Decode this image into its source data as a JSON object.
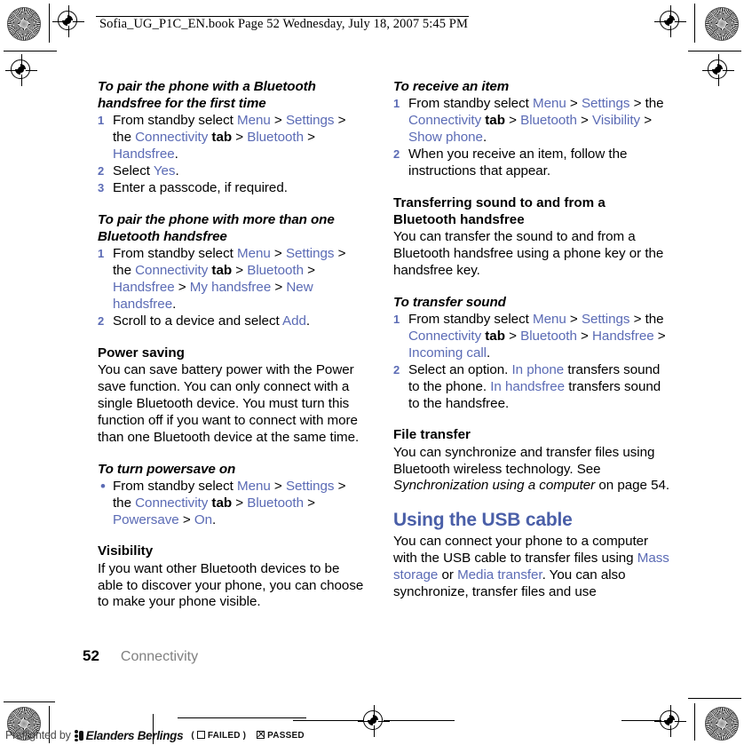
{
  "document": {
    "header_text": "Sofia_UG_P1C_EN.book  Page 52  Wednesday, July 18, 2007  5:45 PM",
    "folio_page": "52",
    "folio_chapter": "Connectivity",
    "link_color": "#5b6bb5",
    "heading_color": "#4a5fa8",
    "chapter_label_color": "#808080"
  },
  "preflight": {
    "label": "Preflighted by",
    "brand": "Elanders Berlings",
    "failed_open_paren": "(",
    "failed_label": "FAILED",
    "failed_close_paren": ")",
    "passed_label": "PASSED"
  },
  "left_column": {
    "s1": {
      "heading": "To pair the phone with a Bluetooth handsfree for the first time",
      "steps": [
        {
          "num": "1",
          "runs": [
            {
              "t": "From standby select ",
              "s": "n"
            },
            {
              "t": "Menu",
              "s": "lk"
            },
            {
              "t": " > ",
              "s": "n"
            },
            {
              "t": "Settings",
              "s": "lk"
            },
            {
              "t": " > the ",
              "s": "n"
            },
            {
              "t": "Connectivity",
              "s": "lk"
            },
            {
              "t": " tab",
              "s": "bd"
            },
            {
              "t": " > ",
              "s": "n"
            },
            {
              "t": "Bluetooth",
              "s": "lk"
            },
            {
              "t": " > ",
              "s": "n"
            },
            {
              "t": "Handsfree",
              "s": "lk"
            },
            {
              "t": ".",
              "s": "n"
            }
          ]
        },
        {
          "num": "2",
          "runs": [
            {
              "t": "Select ",
              "s": "n"
            },
            {
              "t": "Yes",
              "s": "lk"
            },
            {
              "t": ".",
              "s": "n"
            }
          ]
        },
        {
          "num": "3",
          "runs": [
            {
              "t": "Enter a passcode, if required.",
              "s": "n"
            }
          ]
        }
      ]
    },
    "s2": {
      "heading": "To pair the phone with more than one Bluetooth handsfree",
      "steps": [
        {
          "num": "1",
          "runs": [
            {
              "t": "From standby select ",
              "s": "n"
            },
            {
              "t": "Menu",
              "s": "lk"
            },
            {
              "t": " > ",
              "s": "n"
            },
            {
              "t": "Settings",
              "s": "lk"
            },
            {
              "t": " > the ",
              "s": "n"
            },
            {
              "t": "Connectivity",
              "s": "lk"
            },
            {
              "t": " tab",
              "s": "bd"
            },
            {
              "t": " > ",
              "s": "n"
            },
            {
              "t": "Bluetooth",
              "s": "lk"
            },
            {
              "t": " > ",
              "s": "n"
            },
            {
              "t": "Handsfree",
              "s": "lk"
            },
            {
              "t": " > ",
              "s": "n"
            },
            {
              "t": "My handsfree",
              "s": "lk"
            },
            {
              "t": " > ",
              "s": "n"
            },
            {
              "t": "New handsfree",
              "s": "lk"
            },
            {
              "t": ".",
              "s": "n"
            }
          ]
        },
        {
          "num": "2",
          "runs": [
            {
              "t": "Scroll to a device and select ",
              "s": "n"
            },
            {
              "t": "Add",
              "s": "lk"
            },
            {
              "t": ".",
              "s": "n"
            }
          ]
        }
      ]
    },
    "s3": {
      "heading": "Power saving",
      "body": "You can save battery power with the Power save function. You can only connect with a single Bluetooth device. You must turn this function off if you want to connect with more than one Bluetooth device at the same time."
    },
    "s4": {
      "heading": "To turn powersave on",
      "bullet": "•",
      "steps": [
        {
          "runs": [
            {
              "t": "From standby select ",
              "s": "n"
            },
            {
              "t": "Menu",
              "s": "lk"
            },
            {
              "t": " > ",
              "s": "n"
            },
            {
              "t": "Settings",
              "s": "lk"
            },
            {
              "t": " > the ",
              "s": "n"
            },
            {
              "t": "Connectivity",
              "s": "lk"
            },
            {
              "t": " tab",
              "s": "bd"
            },
            {
              "t": " > ",
              "s": "n"
            },
            {
              "t": "Bluetooth",
              "s": "lk"
            },
            {
              "t": " > ",
              "s": "n"
            },
            {
              "t": "Powersave",
              "s": "lk"
            },
            {
              "t": " > ",
              "s": "n"
            },
            {
              "t": "On",
              "s": "lk"
            },
            {
              "t": ".",
              "s": "n"
            }
          ]
        }
      ]
    },
    "s5": {
      "heading": "Visibility",
      "body": "If you want other Bluetooth devices to be able to discover your phone, you can choose to make your phone visible."
    }
  },
  "right_column": {
    "s1": {
      "heading": "To receive an item",
      "steps": [
        {
          "num": "1",
          "runs": [
            {
              "t": "From standby select ",
              "s": "n"
            },
            {
              "t": "Menu",
              "s": "lk"
            },
            {
              "t": " > ",
              "s": "n"
            },
            {
              "t": "Settings",
              "s": "lk"
            },
            {
              "t": " > the ",
              "s": "n"
            },
            {
              "t": "Connectivity",
              "s": "lk"
            },
            {
              "t": " tab",
              "s": "bd"
            },
            {
              "t": " > ",
              "s": "n"
            },
            {
              "t": "Bluetooth",
              "s": "lk"
            },
            {
              "t": " > ",
              "s": "n"
            },
            {
              "t": "Visibility",
              "s": "lk"
            },
            {
              "t": " > ",
              "s": "n"
            },
            {
              "t": "Show phone",
              "s": "lk"
            },
            {
              "t": ".",
              "s": "n"
            }
          ]
        },
        {
          "num": "2",
          "runs": [
            {
              "t": "When you receive an item, follow the instructions that appear.",
              "s": "n"
            }
          ]
        }
      ]
    },
    "s2": {
      "heading": "Transferring sound to and from a Bluetooth handsfree",
      "body": "You can transfer the sound to and from a Bluetooth handsfree using a phone key or the handsfree key."
    },
    "s3": {
      "heading": "To transfer sound",
      "steps": [
        {
          "num": "1",
          "runs": [
            {
              "t": "From standby select ",
              "s": "n"
            },
            {
              "t": "Menu",
              "s": "lk"
            },
            {
              "t": " > ",
              "s": "n"
            },
            {
              "t": "Settings",
              "s": "lk"
            },
            {
              "t": " > the ",
              "s": "n"
            },
            {
              "t": "Connectivity",
              "s": "lk"
            },
            {
              "t": " tab",
              "s": "bd"
            },
            {
              "t": " > ",
              "s": "n"
            },
            {
              "t": "Bluetooth",
              "s": "lk"
            },
            {
              "t": " > ",
              "s": "n"
            },
            {
              "t": "Handsfree",
              "s": "lk"
            },
            {
              "t": " > ",
              "s": "n"
            },
            {
              "t": "Incoming call",
              "s": "lk"
            },
            {
              "t": ".",
              "s": "n"
            }
          ]
        },
        {
          "num": "2",
          "runs": [
            {
              "t": "Select an option. ",
              "s": "n"
            },
            {
              "t": "In phone",
              "s": "lk"
            },
            {
              "t": " transfers sound to the phone. ",
              "s": "n"
            },
            {
              "t": "In handsfree",
              "s": "lk"
            },
            {
              "t": " transfers sound to the handsfree.",
              "s": "n"
            }
          ]
        }
      ]
    },
    "s4": {
      "heading": "File transfer",
      "runs": [
        {
          "t": "You can synchronize and transfer files using Bluetooth wireless technology. See ",
          "s": "n"
        },
        {
          "t": "Synchronization using a computer",
          "s": "it"
        },
        {
          "t": " on page 54.",
          "s": "n"
        }
      ]
    },
    "s5": {
      "heading": "Using the USB cable",
      "runs": [
        {
          "t": "You can connect your phone to a computer with the USB cable to transfer files using ",
          "s": "n"
        },
        {
          "t": "Mass storage",
          "s": "lk"
        },
        {
          "t": " or ",
          "s": "n"
        },
        {
          "t": "Media transfer",
          "s": "lk"
        },
        {
          "t": ". You can also synchronize, transfer files and use",
          "s": "n"
        }
      ]
    }
  }
}
